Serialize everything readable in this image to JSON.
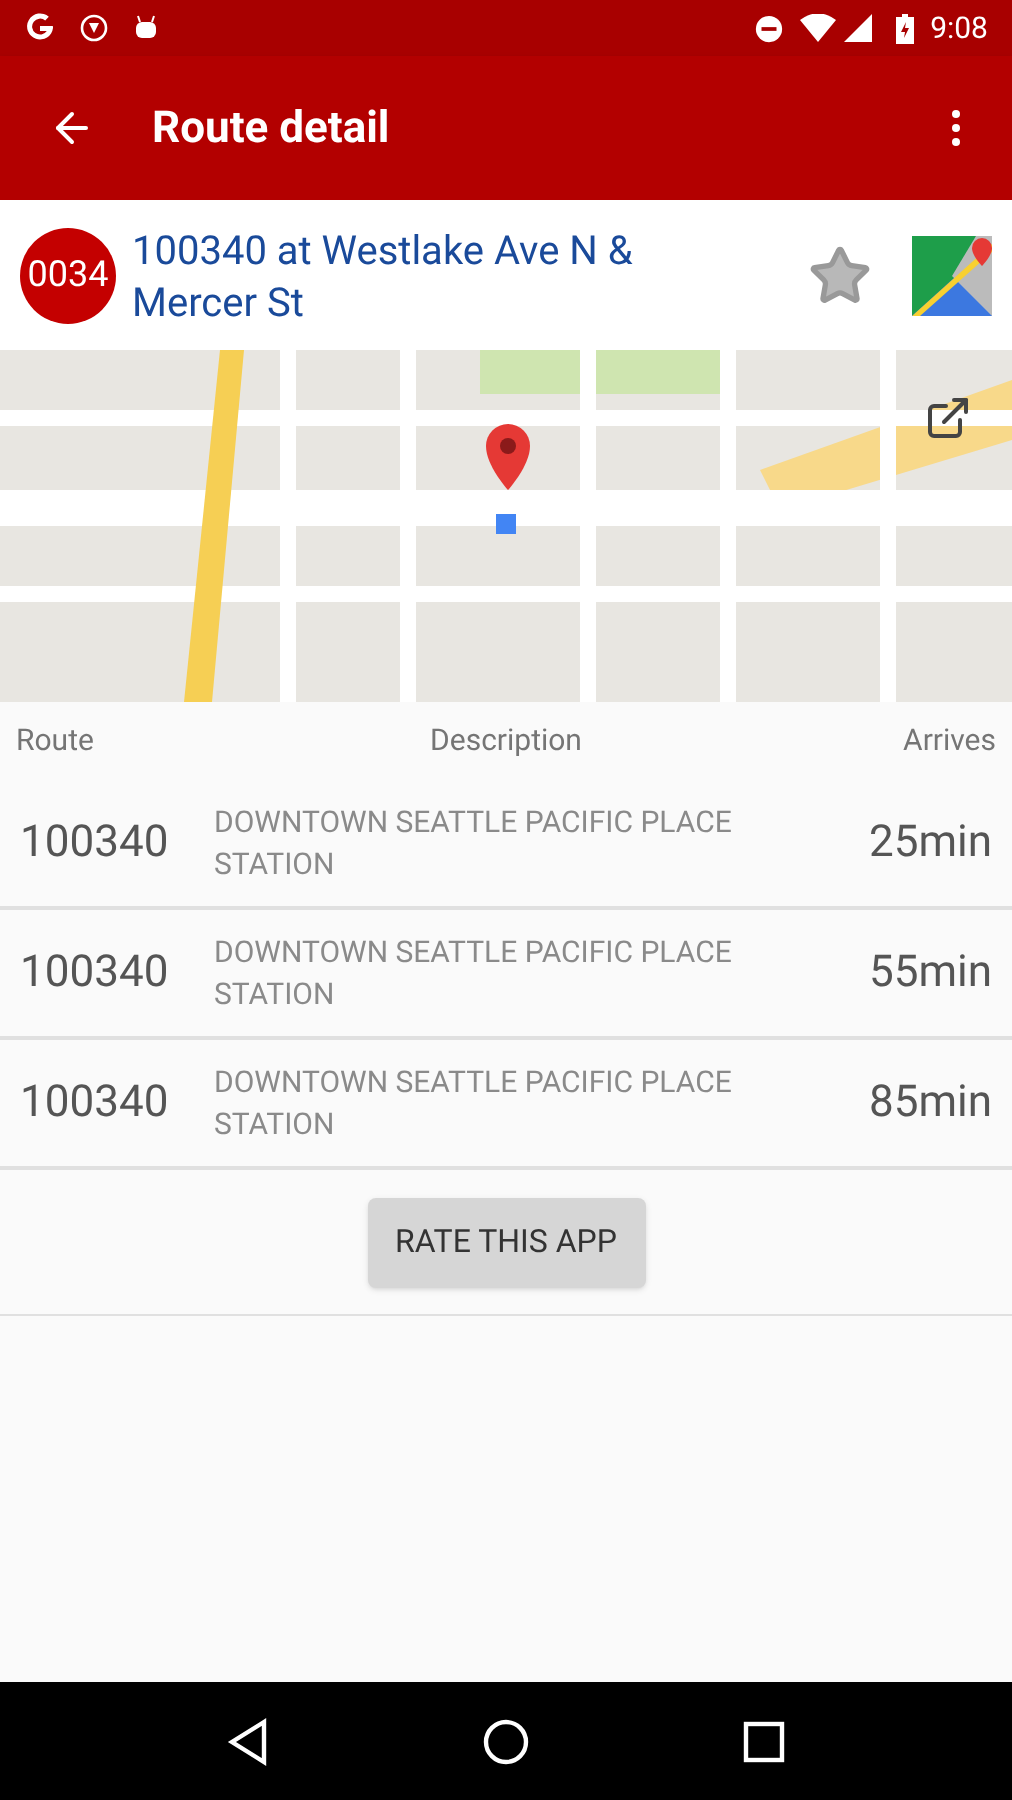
{
  "status_bar": {
    "time": "9:08"
  },
  "toolbar": {
    "title": "Route detail"
  },
  "stop": {
    "badge": "0034",
    "name": "100340 at Westlake Ave N & Mercer St",
    "favorite": false
  },
  "table": {
    "columns": [
      "Route",
      "Description",
      "Arrives"
    ],
    "rows": [
      {
        "route": "100340",
        "description": "DOWNTOWN SEATTLE PACIFIC PLACE STATION",
        "arrives": "25min"
      },
      {
        "route": "100340",
        "description": "DOWNTOWN SEATTLE PACIFIC PLACE STATION",
        "arrives": "55min"
      },
      {
        "route": "100340",
        "description": "DOWNTOWN SEATTLE PACIFIC PLACE STATION",
        "arrives": "85min"
      }
    ]
  },
  "rate_button": "RATE THIS APP"
}
